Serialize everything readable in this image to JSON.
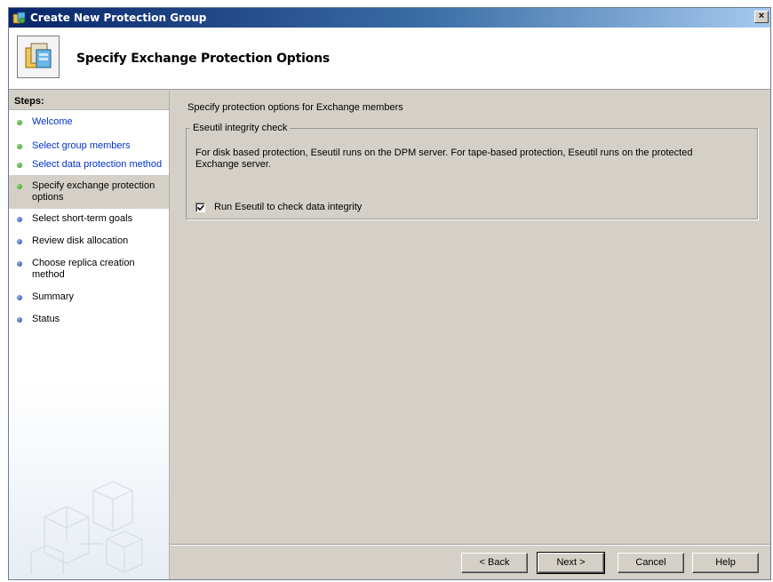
{
  "window": {
    "title": "Create New Protection Group",
    "close_label": "×"
  },
  "header": {
    "title": "Specify Exchange Protection Options"
  },
  "steps": {
    "heading": "Steps:",
    "items": [
      {
        "label": "Welcome",
        "state": "done"
      },
      {
        "label": "Select group members",
        "state": "done"
      },
      {
        "label": "Select data protection method",
        "state": "done"
      },
      {
        "label": "Specify exchange protection options",
        "state": "active"
      },
      {
        "label": "Select short-term goals",
        "state": "todo"
      },
      {
        "label": "Review disk allocation",
        "state": "todo"
      },
      {
        "label": "Choose replica creation method",
        "state": "todo"
      },
      {
        "label": "Summary",
        "state": "todo"
      },
      {
        "label": "Status",
        "state": "todo"
      }
    ]
  },
  "main": {
    "intro": "Specify protection options for Exchange members",
    "group_legend": "Eseutil integrity check",
    "group_description": "For disk based protection, Eseutil runs on the DPM server. For tape-based protection, Eseutil runs on the protected Exchange server.",
    "checkbox_label": "Run Eseutil to check data integrity",
    "checkbox_checked": true
  },
  "buttons": {
    "back": "< Back",
    "next": "Next >",
    "cancel": "Cancel",
    "help": "Help"
  },
  "colors": {
    "title_bar": "#0a246a",
    "dialog_bg": "#d4d0c8",
    "link_step": "#0033cc",
    "done_bullet": "#2e8b1e",
    "todo_bullet": "#1e3ea0"
  }
}
